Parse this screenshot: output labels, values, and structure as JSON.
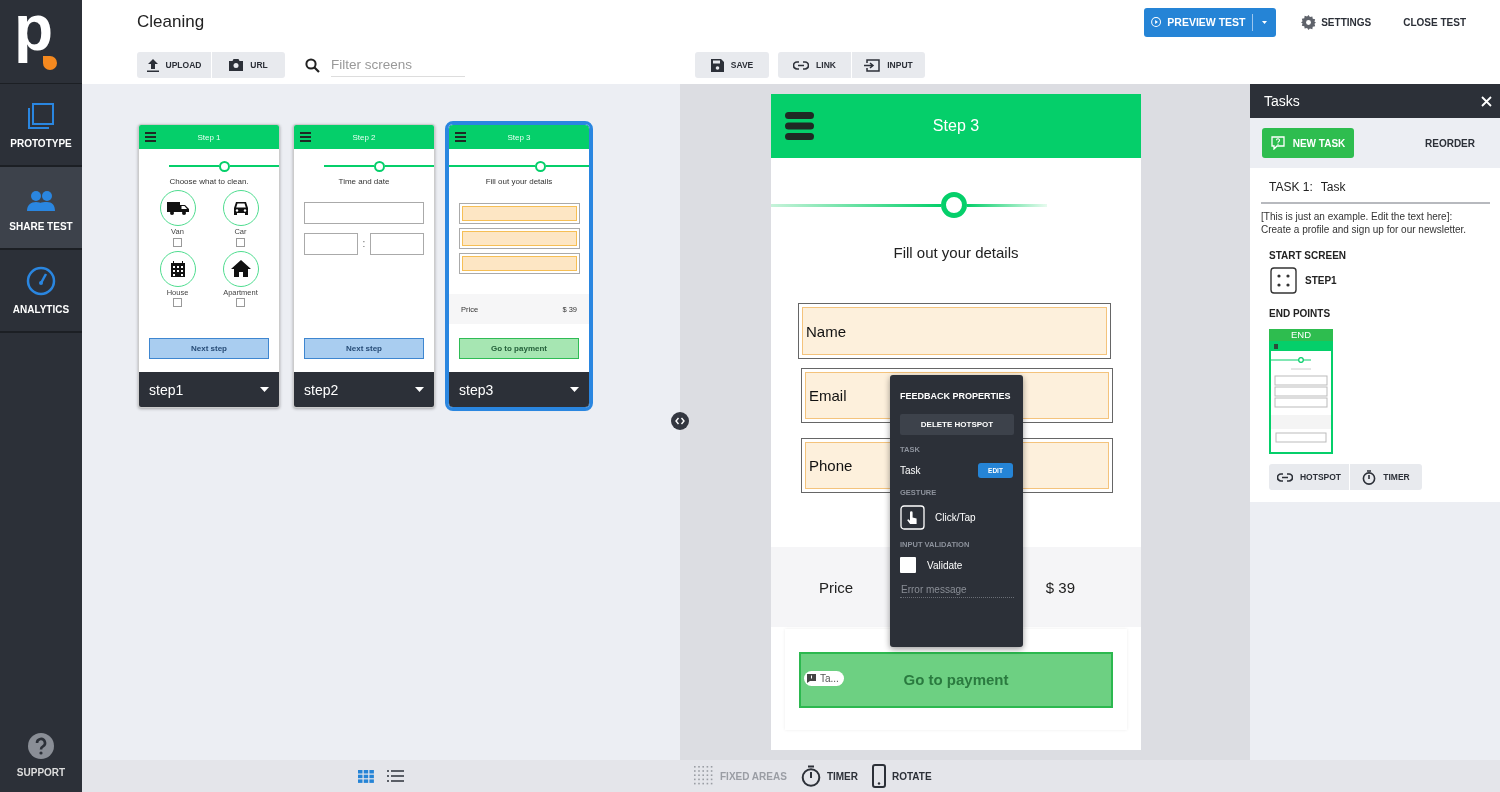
{
  "sidebar": {
    "logo": "p",
    "nav": [
      {
        "label": "PROTOTYPE",
        "selected": false
      },
      {
        "label": "SHARE TEST",
        "selected": true
      },
      {
        "label": "ANALYTICS",
        "selected": false
      }
    ],
    "support": "SUPPORT"
  },
  "header": {
    "title": "Cleaning",
    "upload": "UPLOAD",
    "url": "URL",
    "filter_placeholder": "Filter screens",
    "save": "SAVE",
    "link": "LINK",
    "input": "INPUT",
    "preview": "PREVIEW TEST",
    "settings": "SETTINGS",
    "close": "CLOSE TEST"
  },
  "screens": [
    {
      "name": "step1",
      "selected": false,
      "kind": "choose",
      "header": "Step 1",
      "heading": "Choose what to clean.",
      "options": [
        {
          "label": "Van",
          "checked": false
        },
        {
          "label": "Car",
          "checked": false
        },
        {
          "label": "House",
          "checked": false
        },
        {
          "label": "Apartment",
          "checked": false
        }
      ],
      "button": "Next step"
    },
    {
      "name": "step2",
      "selected": false,
      "kind": "datetime",
      "header": "Step 2",
      "heading": "Time and date",
      "separator": ":",
      "button": "Next step"
    },
    {
      "name": "step3",
      "selected": true,
      "kind": "details",
      "header": "Step 3",
      "heading": "Fill out your details",
      "price_label": "Price",
      "price": "$ 39",
      "button": "Go to payment"
    }
  ],
  "preview": {
    "header": "Step 3",
    "heading": "Fill out your details",
    "fields": [
      {
        "label": "Name"
      },
      {
        "label": "Email"
      },
      {
        "label": "Phone"
      }
    ],
    "price_label": "Price",
    "price": "$ 39",
    "button": "Go to payment",
    "badge": "Ta..."
  },
  "popup": {
    "title": "FEEDBACK PROPERTIES",
    "delete": "DELETE HOTSPOT",
    "task_section": "TASK",
    "task": "Task",
    "edit": "EDIT",
    "gesture_section": "GESTURE",
    "gesture": "Click/Tap",
    "validation_section": "INPUT VALIDATION",
    "validate": {
      "label": "Validate",
      "checked": false
    },
    "error_placeholder": "Error message"
  },
  "tasks": {
    "title": "Tasks",
    "new_task": "NEW TASK",
    "reorder": "REORDER",
    "task_label": "TASK 1:",
    "task_name": "Task",
    "description": "[This is just an example. Edit the text here]:\nCreate a profile and sign up for our newsletter.",
    "start_label": "START SCREEN",
    "start_screen": "STEP1",
    "end_label": "END POINTS",
    "end_badge": "END",
    "hotspot": "HOTSPOT",
    "timer": "TIMER"
  },
  "bottom_bar": {
    "views": [
      {
        "selected": true
      },
      {
        "selected": false
      }
    ],
    "tools": [
      {
        "label": "FIXED AREAS",
        "disabled": true
      },
      {
        "label": "TIMER",
        "disabled": false
      },
      {
        "label": "ROTATE",
        "disabled": false
      }
    ]
  }
}
